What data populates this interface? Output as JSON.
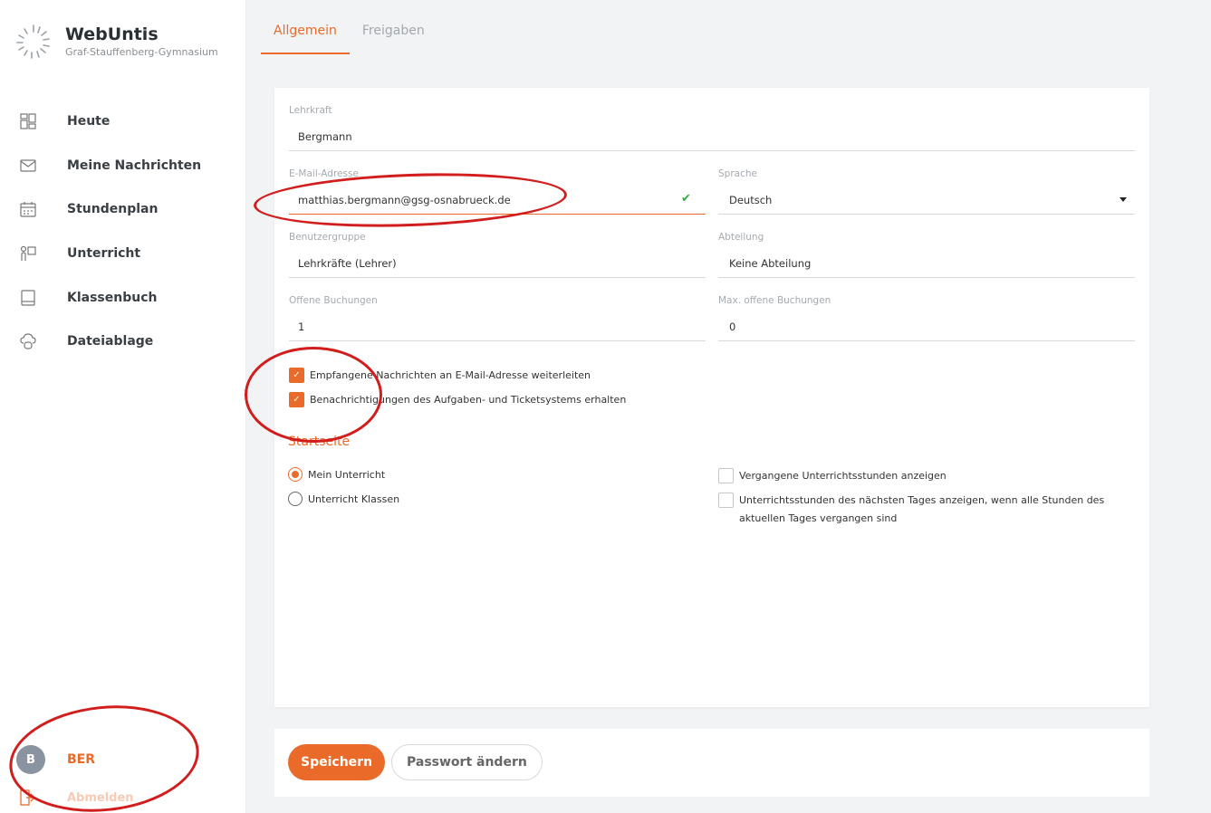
{
  "brand": {
    "title": "WebUntis",
    "subtitle": "Graf-Stauffenberg-Gymnasium"
  },
  "nav": [
    {
      "label": "Heute",
      "icon": "grid-icon"
    },
    {
      "label": "Meine Nachrichten",
      "icon": "envelope-icon"
    },
    {
      "label": "Stundenplan",
      "icon": "calendar-icon"
    },
    {
      "label": "Unterricht",
      "icon": "teacher-board-icon"
    },
    {
      "label": "Klassenbuch",
      "icon": "book-icon"
    },
    {
      "label": "Dateiablage",
      "icon": "cloud-icon"
    }
  ],
  "user": {
    "initial": "B",
    "name": "BER",
    "logout_label": "Abmelden"
  },
  "tabs": [
    {
      "label": "Allgemein",
      "active": true
    },
    {
      "label": "Freigaben",
      "active": false
    }
  ],
  "form": {
    "teacher_label": "Lehrkraft",
    "teacher_value": "Bergmann",
    "email_label": "E-Mail-Adresse",
    "email_value": "matthias.bergmann@gsg-osnabrueck.de",
    "language_label": "Sprache",
    "language_value": "Deutsch",
    "usergroup_label": "Benutzergruppe",
    "usergroup_value": "Lehrkräfte (Lehrer)",
    "department_label": "Abteilung",
    "department_value": "Keine Abteilung",
    "open_bookings_label": "Offene Buchungen",
    "open_bookings_value": "1",
    "max_open_bookings_label": "Max. offene Buchungen",
    "max_open_bookings_value": "0"
  },
  "checkboxes": {
    "forward_messages": "Empfangene Nachrichten an E-Mail-Adresse weiterleiten",
    "ticket_notifications": "Benachrichtigungen des Aufgaben- und Ticketsystems erhalten"
  },
  "startpage": {
    "title": "Startseite",
    "radio_own": "Mein Unterricht",
    "radio_classes": "Unterricht Klassen",
    "opt_past": "Vergangene Unterrichtsstunden anzeigen",
    "opt_next_day": "Unterrichtsstunden des nächsten Tages anzeigen, wenn alle Stunden des aktuellen Tages vergangen sind"
  },
  "footer": {
    "save_label": "Speichern",
    "password_label": "Passwort ändern"
  },
  "colors": {
    "accent": "#ea6a2a",
    "annotation": "#d21d1d"
  }
}
